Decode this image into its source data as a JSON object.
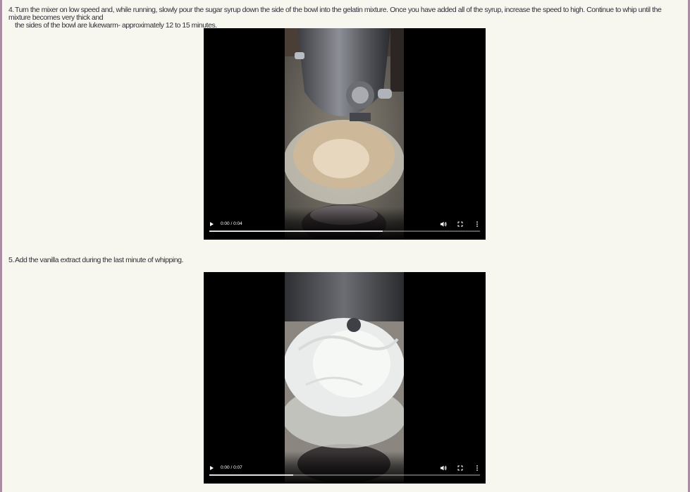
{
  "steps": [
    {
      "number": "4.",
      "line1": "Turn the mixer on low speed and, while running, slowly pour the sugar syrup down the side of the bowl into the gelatin mixture. Once you have added all of the syrup, increase the speed to high. Continue to whip until the mixture becomes very thick and",
      "line2": "the sides of the bowl are lukewarm- approximately 12 to 15 minutes.",
      "video": {
        "time": "0:00 / 0:04",
        "buffered_fraction": 0.64,
        "play_icon": "play-icon",
        "volume_icon": "volume-icon",
        "fullscreen_icon": "fullscreen-icon",
        "more_icon": "more-options-icon"
      }
    },
    {
      "number": "5.",
      "line1": "Add the vanilla extract during the last minute of whipping.",
      "video": {
        "time": "0:00 / 0:07",
        "buffered_fraction": 0.31,
        "play_icon": "play-icon",
        "volume_icon": "volume-icon",
        "fullscreen_icon": "fullscreen-icon",
        "more_icon": "more-options-icon"
      }
    }
  ],
  "colors": {
    "page_background": "#f7f6ef",
    "text": "#2f2f38",
    "frame_border": "#a98ea3"
  }
}
